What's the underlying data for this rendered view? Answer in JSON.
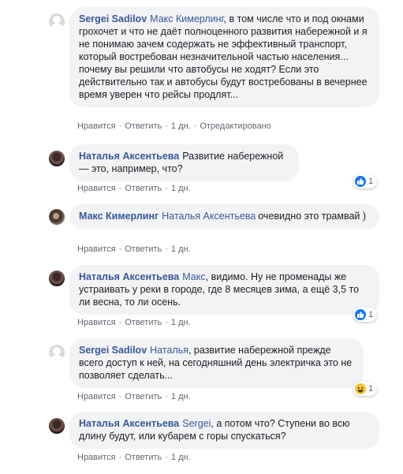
{
  "comments": [
    {
      "author": "Sergei Sadilov",
      "mention": "Макс Кимерлинг",
      "text": ", в том числе что и под окнами грохочет и что не даёт полноценного развития набережной и я не понимаю зачем содержать не эффективный транспорт, который востребован незначительной частью населения... почему вы решили что автобусы не ходят? Если это действительно так и автобусы будут востребованы в вечернее время уверен что рейсы продлят...",
      "like": "Нравится",
      "reply": "Ответить",
      "time": "1 дн.",
      "edited": "Отредактировано",
      "avatar": "default-avatar-icon"
    },
    {
      "author": "Наталья Аксентьева",
      "mention": "",
      "text": "Развитие набережной — это, например, что?",
      "like": "Нравится",
      "reply": "Ответить",
      "time": "1 дн.",
      "reaction_count": "1",
      "reaction_icon": "like-reaction-icon",
      "avatar": "user-photo"
    },
    {
      "author": "Макс Кимерлинг",
      "mention": "Наталья Аксентьева",
      "text": "очевидно это трамвай )",
      "like": "Нравится",
      "reply": "Ответить",
      "time": "1 дн.",
      "avatar": "user-photo"
    },
    {
      "author": "Наталья Аксентьева",
      "mention": "Макс",
      "text": ", видимо. Ну не променады же устраивать у реки в городе, где 8 месяцев зима, а ещё 3,5 то ли весна, то ли осень.",
      "like": "Нравится",
      "reply": "Ответить",
      "time": "1 дн.",
      "reaction_count": "1",
      "reaction_icon": "like-reaction-icon",
      "avatar": "user-photo"
    },
    {
      "author": "Sergei Sadilov",
      "mention": "Наталья",
      "text": ", развитие набережной прежде всего доступ к ней, на сегодняшний день электричка это не позволяет сделать...",
      "like": "Нравится",
      "reply": "Ответить",
      "time": "1 дн.",
      "reaction_count": "1",
      "reaction_icon": "haha-reaction-icon",
      "avatar": "default-avatar-icon"
    },
    {
      "author": "Наталья Аксентьева",
      "mention": "Sergei",
      "text": ", а потом что? Ступени во всю длину будут, или кубарем с горы спускаться?",
      "like": "Нравится",
      "reply": "Ответить",
      "time": "1 дн.",
      "avatar": "user-photo"
    }
  ],
  "colors": {
    "link": "#385898",
    "bubble": "#f2f3f5",
    "meta": "#606770",
    "like": "#1877f2",
    "haha": "#f7c23a"
  }
}
